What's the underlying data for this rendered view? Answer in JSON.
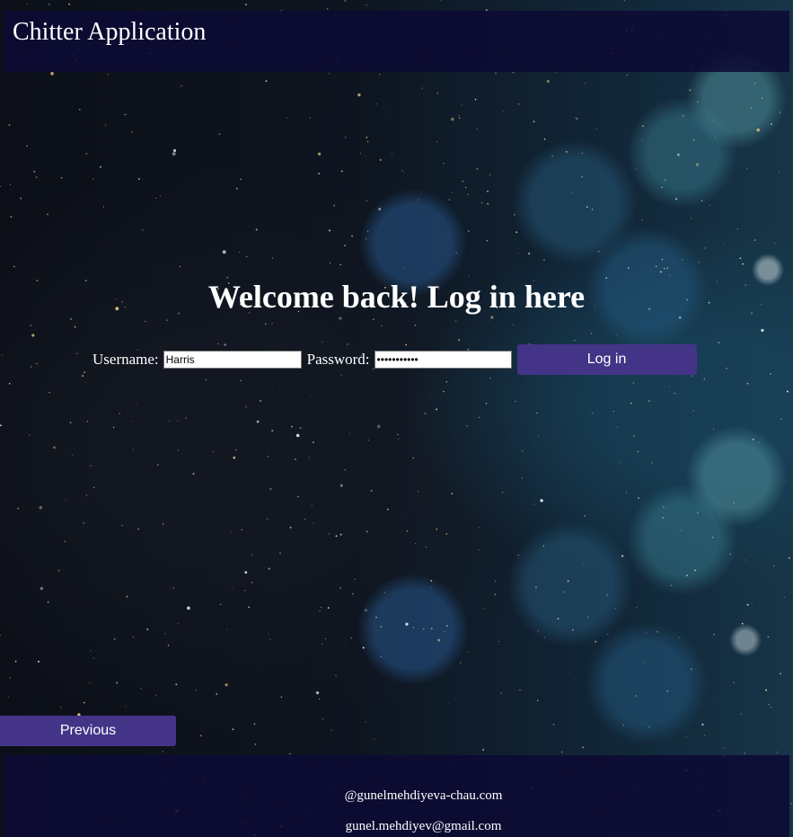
{
  "header": {
    "title": "Chitter Application"
  },
  "main": {
    "heading": "Welcome back! Log in here",
    "username": {
      "label": "Username:",
      "value": "Harris"
    },
    "password": {
      "label": "Password:",
      "value": "•••••••••••"
    },
    "login_button": "Log in",
    "previous_button": "Previous"
  },
  "footer": {
    "handle": "@gunelmehdiyeva-chau.com",
    "email": "gunel.mehdiyev@gmail.com"
  },
  "colors": {
    "header_band": "#0c0a34",
    "button": "#433488",
    "text": "#ffffff",
    "background_accent": "#163547"
  }
}
